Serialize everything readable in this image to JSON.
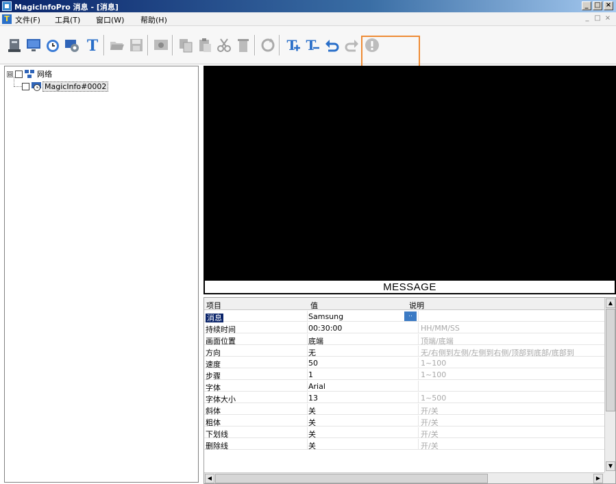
{
  "window": {
    "title": "MagicInfoPro 消息 - [消息]",
    "controls": [
      "_",
      "□",
      "×"
    ]
  },
  "menu": {
    "items": [
      "文件(F)",
      "工具(T)",
      "窗口(W)",
      "帮助(H)"
    ],
    "mdi_controls": [
      "_",
      "□",
      "×"
    ]
  },
  "toolbar": {
    "buttons": [
      "uploader-icon",
      "monitor-icon",
      "schedule-icon",
      "settings-icon",
      "text-message-icon",
      "open-folder-icon",
      "save-icon",
      "preview-icon",
      "copy-icon",
      "paste-icon",
      "cut-icon",
      "delete-icon",
      "refresh-icon",
      "text-add-icon",
      "text-remove-icon",
      "undo-icon",
      "redo-icon",
      "info-icon"
    ],
    "highlight_color": "#ee8a33"
  },
  "tree": {
    "root_expander": "⊟",
    "root_label": "网络",
    "child_label": "MagicInfo#0002"
  },
  "preview": {
    "background": "#000000",
    "message_text": "MESSAGE"
  },
  "properties": {
    "headers": {
      "name": "项目",
      "value": "值",
      "desc": "说明"
    },
    "rows": [
      {
        "name": "消息",
        "value": "Samsung",
        "desc": ""
      },
      {
        "name": "持续时间",
        "value": "00:30:00",
        "desc": "HH/MM/SS"
      },
      {
        "name": "画面位置",
        "value": "底端",
        "desc": "顶端/底端"
      },
      {
        "name": "方向",
        "value": "无",
        "desc": "无/右侧到左侧/左侧到右侧/顶部到底部/底部到"
      },
      {
        "name": "速度",
        "value": "50",
        "desc": "1~100"
      },
      {
        "name": "步骤",
        "value": "1",
        "desc": "1~100"
      },
      {
        "name": "字体",
        "value": "Arial",
        "desc": ""
      },
      {
        "name": "字体大小",
        "value": "13",
        "desc": "1~500"
      },
      {
        "name": "斜体",
        "value": "关",
        "desc": "开/关"
      },
      {
        "name": "粗体",
        "value": "关",
        "desc": "开/关"
      },
      {
        "name": "下划线",
        "value": "关",
        "desc": "开/关"
      },
      {
        "name": "删除线",
        "value": "关",
        "desc": "开/关"
      }
    ],
    "ellipsis": ".."
  }
}
